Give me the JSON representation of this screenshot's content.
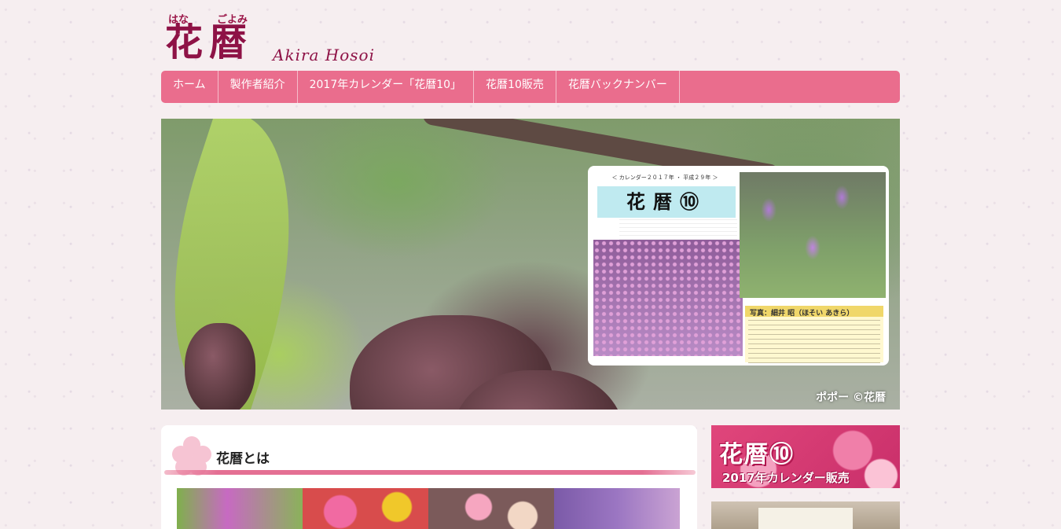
{
  "logo": {
    "ruby_hana": "はな",
    "ruby_goyomi": "ごよみ",
    "kanji": "花暦",
    "latin": "Akira Hosoi"
  },
  "nav": {
    "items": [
      {
        "label": "ホーム"
      },
      {
        "label": "製作者紹介"
      },
      {
        "label": "2017年カレンダー「花暦10」"
      },
      {
        "label": "花暦10販売"
      },
      {
        "label": "花暦バックナンバー"
      }
    ]
  },
  "hero": {
    "credit": "ポポー ©花暦",
    "card": {
      "title": "＜ カレンダー２０１７年 ・ 平成２９年 ＞",
      "heading": "花暦⑩",
      "box_label": "写真：細井 昭（ほそい あきら）"
    }
  },
  "main": {
    "title": "花暦とは"
  },
  "sidebar": {
    "banner_title": "花暦⑩",
    "banner_subtitle": "2017年カレンダー販売"
  },
  "colors": {
    "brand": "#8e1246",
    "nav_bg": "#ea6d8d",
    "accent_brush": "#e46f93"
  }
}
